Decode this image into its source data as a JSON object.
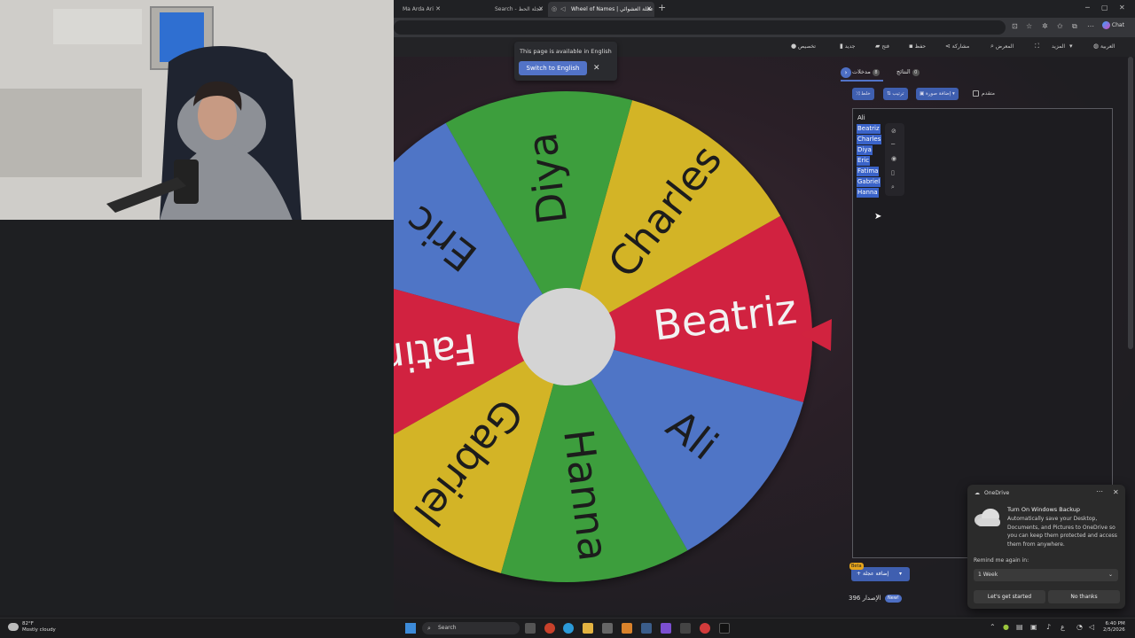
{
  "browser": {
    "tabs": [
      {
        "title": "Ma Arda Ari",
        "active": false
      },
      {
        "title": "Search - عجلة الحظ",
        "active": false
      },
      {
        "title": "Wheel of Names | عجلة العشوائي",
        "active": true
      }
    ],
    "chat_label": "Chat"
  },
  "menubar": {
    "items": [
      "تخصيص",
      "جديد",
      "فتح",
      "حفظ",
      "مشاركة",
      "المعرض",
      "المزيد",
      "العربية"
    ]
  },
  "translate_popup": {
    "text": "This page is available in English",
    "button": "Switch to English"
  },
  "wheel": {
    "segments": [
      {
        "label": "Beatriz",
        "color": "#d1233f"
      },
      {
        "label": "Charles",
        "color": "#d3b428"
      },
      {
        "label": "Diya",
        "color": "#3c9e3e"
      },
      {
        "label": "Eric",
        "color": "#4f75c6"
      },
      {
        "label": "Fatima",
        "color": "#d1233f"
      },
      {
        "label": "Gabriel",
        "color": "#d3b428"
      },
      {
        "label": "Hanna",
        "color": "#3c9e3e"
      },
      {
        "label": "Ali",
        "color": "#4f75c6"
      }
    ],
    "center_color": "#d4d4d4",
    "pointer_color": "#d1233f"
  },
  "panel": {
    "tab_entries": {
      "label": "مدخلات",
      "count": "8"
    },
    "tab_results": {
      "label": "النتائج",
      "count": "0"
    },
    "shuffle_label": "خلط",
    "sort_label": "ترتيب",
    "add_image_label": "إضافة صورة",
    "advanced_label": "متقدم",
    "entries": [
      "Ali",
      "Beatriz",
      "Charles",
      "Diya",
      "Eric",
      "Fatima",
      "Gabriel",
      "Hanna"
    ],
    "add_wheel_label": "إضافة عجلة",
    "beta_label": "Beta",
    "version_label": "396 الإصدار",
    "new_badge": "New!"
  },
  "toast": {
    "app": "OneDrive",
    "title": "Turn On Windows Backup",
    "body": "Automatically save your Desktop, Documents, and Pictures to OneDrive so you can keep them protected and access them from anywhere.",
    "remind_label": "Remind me again in:",
    "remind_value": "1 Week",
    "primary_button": "Let's get started",
    "secondary_button": "No thanks"
  },
  "taskbar": {
    "weather_temp": "82°F",
    "weather_desc": "Mostly cloudy",
    "search_placeholder": "Search",
    "time": "6:40 PM",
    "date": "2/5/2026"
  }
}
